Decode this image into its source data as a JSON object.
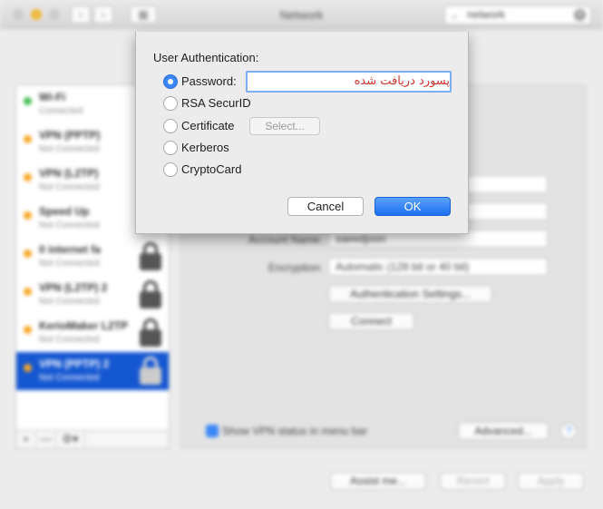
{
  "window": {
    "title": "Network",
    "search_value": "network",
    "nav_back": "‹",
    "nav_forward": "›",
    "grid": "▦"
  },
  "sidebar": {
    "items": [
      {
        "name": "Wi-Fi",
        "status": "Connected",
        "dot": "#3fbd4f"
      },
      {
        "name": "VPN (PPTP)",
        "status": "Not Connected",
        "dot": "#f5a623"
      },
      {
        "name": "VPN (L2TP)",
        "status": "Not Connected",
        "dot": "#f5a623"
      },
      {
        "name": "Speed Up",
        "status": "Not Connected",
        "dot": "#f5a623"
      },
      {
        "name": "0 internet fa",
        "status": "Not Connected",
        "dot": "#f5a623"
      },
      {
        "name": "VPN (L2TP) 2",
        "status": "Not Connected",
        "dot": "#f5a623"
      },
      {
        "name": "KerioMaker L2TP",
        "status": "Not Connected",
        "dot": "#f5a623"
      },
      {
        "name": "VPN (PPTP) 2",
        "status": "Not Connected",
        "dot": "#f5a623"
      }
    ],
    "tools": {
      "add": "+",
      "remove": "—",
      "gear": "⚙▾"
    }
  },
  "panel": {
    "account_name_label": "Account Name:",
    "account_name_value": "saeedjoon",
    "encryption_label": "Encryption:",
    "encryption_value": "Automatic (128 bit or 40 bit)",
    "auth_settings_button": "Authentication Settings...",
    "connect_button": "Connect",
    "show_vpn_status_label": "Show VPN status in menu bar",
    "advanced_button": "Advanced...",
    "help": "?"
  },
  "footer": {
    "assist_button": "Assist me...",
    "revert_button": "Revert",
    "apply_button": "Apply"
  },
  "sheet": {
    "title": "User Authentication:",
    "options": [
      {
        "label": "Password:",
        "selected": true
      },
      {
        "label": "RSA SecurID",
        "selected": false
      },
      {
        "label": "Certificate",
        "selected": false
      },
      {
        "label": "Kerberos",
        "selected": false
      },
      {
        "label": "CryptoCard",
        "selected": false
      }
    ],
    "password_value": "پسورد دریافت شده",
    "select_button": "Select...",
    "cancel_button": "Cancel",
    "ok_button": "OK"
  },
  "colors": {
    "accent": "#3b86f5",
    "selected_row": "#1557d1",
    "password_text": "#d0342c"
  }
}
